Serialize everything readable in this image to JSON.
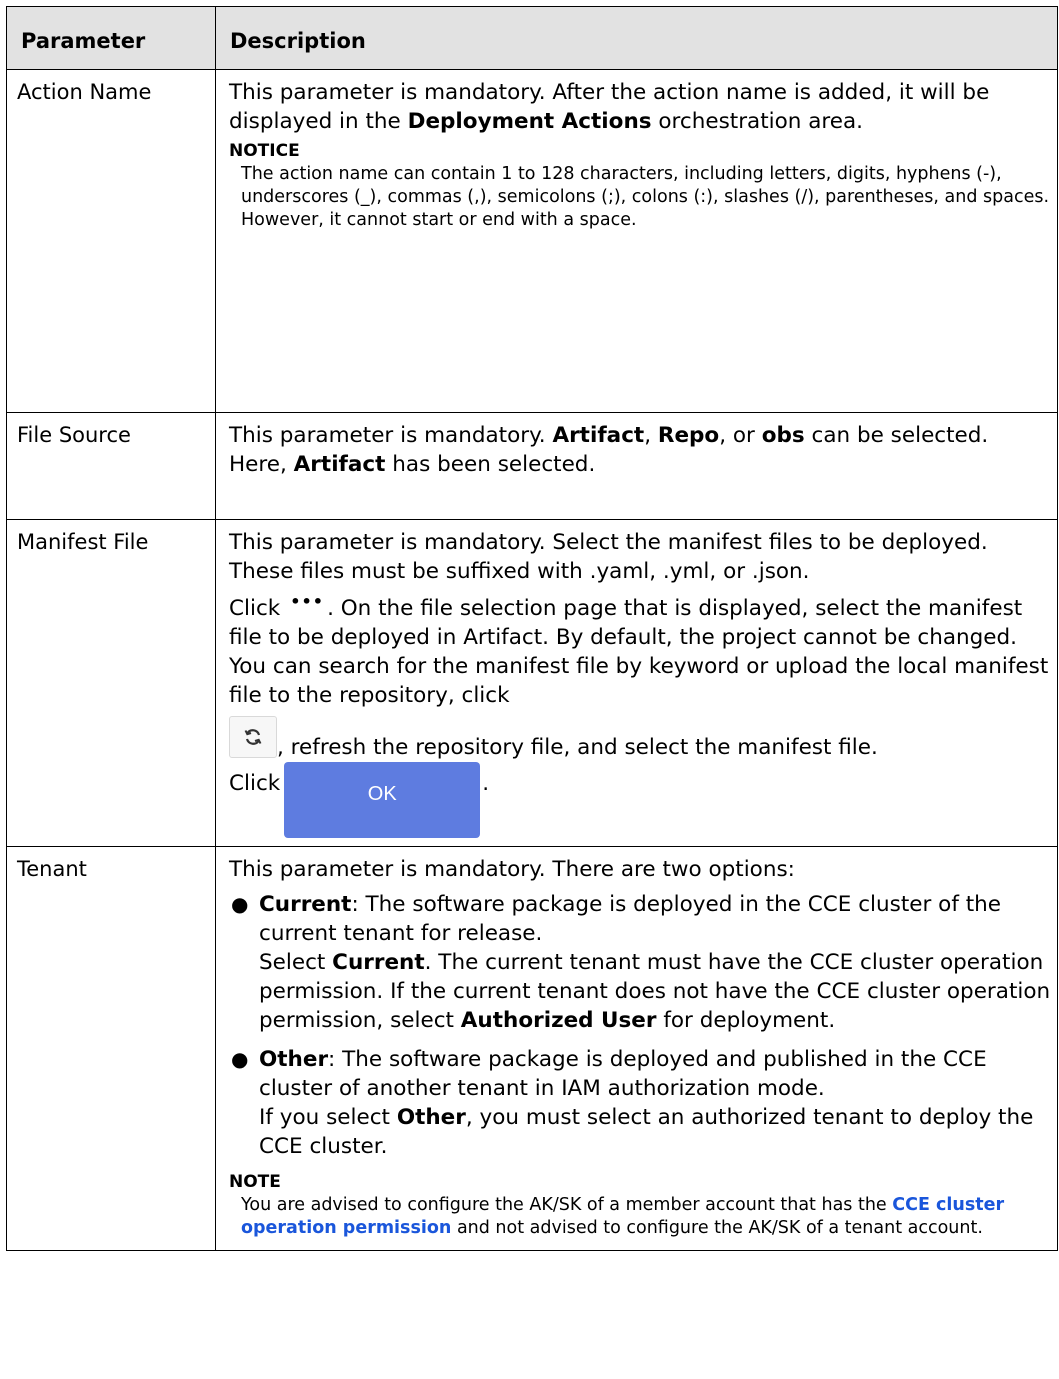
{
  "table": {
    "header": {
      "param": "Parameter",
      "desc": "Description"
    },
    "rows": {
      "action_name": {
        "param": "Action Name",
        "p1_a": "This parameter is mandatory. After the action name is added, it will be displayed in the ",
        "p1_b": "Deployment Actions",
        "p1_c": " orchestration area.",
        "notice_title": "NOTICE",
        "notice_body": "The action name can contain 1 to 128 characters, including letters, digits, hyphens (-), underscores (_), commas (,), semicolons (;), colons (:), slashes (/), parentheses, and spaces. However, it cannot start or end with a space."
      },
      "file_source": {
        "param": "File Source",
        "a": "This parameter is mandatory. ",
        "b": "Artifact",
        "c": ", ",
        "d": "Repo",
        "e": ", or ",
        "f": "obs",
        "g": " can be selected. Here, ",
        "h": "Artifact",
        "i": " has been selected."
      },
      "manifest_file": {
        "param": "Manifest File",
        "p1": "This parameter is mandatory. Select the manifest files to be deployed. These files must be suffixed with .yaml, .yml, or .json.",
        "p2_a": "Click ",
        "more_icon": "•••",
        "p2_b": ". On the file selection page that is displayed, select the manifest file to be deployed in Artifact. By default, the project cannot be changed. You can search for the manifest file by keyword or upload the local manifest file to the repository, click",
        "p2_c": ", refresh the repository file, and select the manifest file.",
        "p3_a": "Click",
        "ok_label": "OK",
        "p3_b": "."
      },
      "tenant": {
        "param": "Tenant",
        "p1": "This parameter is mandatory. There are two options:",
        "b1_title": "Current",
        "b1_a": ": The software package is deployed in the CCE cluster of the current tenant for release.",
        "b1_b": "Select ",
        "b1_c": "Current",
        "b1_d": ". The current tenant must have the CCE cluster operation permission. If the current tenant does not have the CCE cluster operation permission, select ",
        "b1_e": "Authorized User",
        "b1_f": " for deployment.",
        "b2_title": "Other",
        "b2_a": ": The software package is deployed and published in the CCE cluster of another tenant in IAM authorization mode.",
        "b2_b": "If you select ",
        "b2_c": "Other",
        "b2_d": ", you must select an authorized tenant to deploy the CCE cluster.",
        "note_title": "NOTE",
        "note_a": "You are advised to configure the AK/SK of a member account that has the ",
        "note_link": "CCE cluster operation permission",
        "note_b": " and not advised to configure the AK/SK of a tenant account."
      }
    }
  }
}
